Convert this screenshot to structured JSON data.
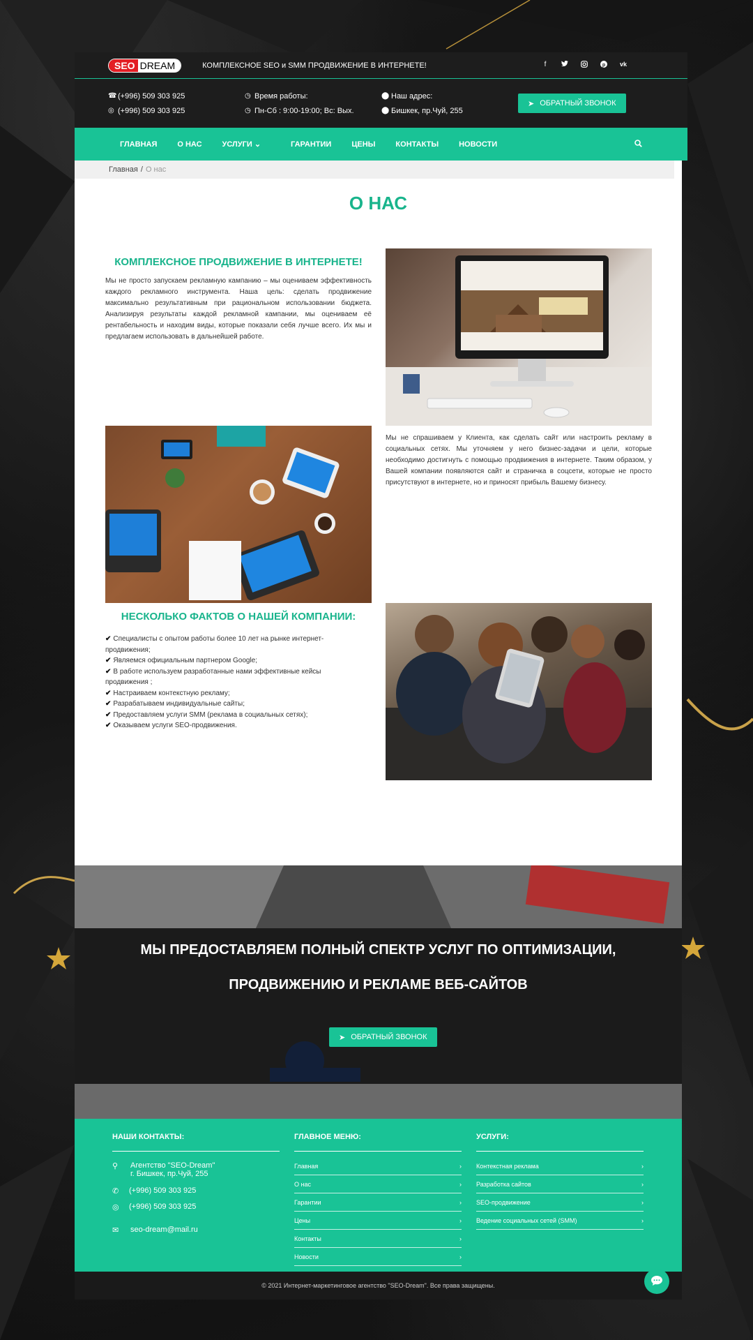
{
  "header": {
    "logo_seo": "SEO",
    "logo_dream": "DREAM",
    "tagline": "КОМПЛЕКСНОЕ SEO и SMM ПРОДВИЖЕНИЕ В ИНТЕРНЕТЕ!",
    "social_icons": [
      "facebook-icon",
      "twitter-icon",
      "instagram-icon",
      "pinterest-icon",
      "vk-icon"
    ]
  },
  "info": {
    "phone1": "(+996) 509 303 925",
    "phone2": "(+996) 509 303 925",
    "hours_label": "Время работы:",
    "hours_value": "Пн-Сб : 9:00-19:00; Вс: Вых.",
    "address_label": "Наш адрес:",
    "address_value": "Бишкек, пр.Чуй, 255",
    "callback": "ОБРАТНЫЙ ЗВОНОК"
  },
  "nav": {
    "items": [
      "ГЛАВНАЯ",
      "О НАС",
      "УСЛУГИ",
      "ГАРАНТИИ",
      "ЦЕНЫ",
      "КОНТАКТЫ",
      "НОВОСТИ"
    ]
  },
  "breadcrumb": {
    "home": "Главная",
    "sep": "/",
    "current": "О нас"
  },
  "page": {
    "title": "О НАС",
    "section1_title": "КОМПЛЕКСНОЕ ПРОДВИЖЕНИЕ В ИНТЕРНЕТЕ!",
    "section1_text": "Мы не просто запускаем рекламную кампанию – мы оцениваем эффективность каждого рекламного инструмента. Наша цель: сделать продвижение максимально результативным при рациональном использовании бюджета. Анализируя результаты каждой рекламной кампании, мы оцениваем её рентабельность и находим виды, которые показали себя лучше всего. Их мы и предлагаем использовать в дальнейшей работе.",
    "section2_text": "Мы не спрашиваем у Клиента, как сделать сайт или настроить рекламу в социальных сетях. Мы уточняем у него бизнес-задачи и цели, которые необходимо достигнуть с помощью продвижения в интернете. Таким образом, у Вашей компании появляются сайт и страничка в соцсети, которые не просто присутствуют в интернете, но и приносят прибыль Вашему бизнесу.",
    "facts_title": "НЕСКОЛЬКО ФАКТОВ О НАШЕЙ КОМПАНИИ:",
    "facts": [
      "Специалисты с опытом работы более 10 лет на рынке интернет-продвижения;",
      "Являемся официальным партнером Google;",
      "В работе используем разработанные нами эффективные кейсы продвижения ;",
      "Настраиваем контекстную рекламу;",
      "Разрабатываем индивидуальные сайты;",
      "Предоставляем услуги SMM (реклама в социальных сетях);",
      "Оказываем услуги SEO-продвижения."
    ]
  },
  "banner": {
    "line1": "МЫ ПРЕДОСТАВЛЯЕМ ПОЛНЫЙ СПЕКТР УСЛУГ ПО ОПТИМИЗАЦИИ,",
    "line2": "ПРОДВИЖЕНИЮ И РЕКЛАМЕ ВЕБ-САЙТОВ",
    "button": "ОБРАТНЫЙ ЗВОНОК"
  },
  "footer": {
    "contacts_title": "НАШИ КОНТАКТЫ:",
    "agency": "Агентство \"SEO-Dream\"",
    "address": "г. Бишкек, пр.Чуй, 255",
    "phone1": "(+996) 509 303 925",
    "phone2": "(+996) 509 303 925",
    "email": "seo-dream@mail.ru",
    "menu_title": "ГЛАВНОЕ МЕНЮ:",
    "menu": [
      "Главная",
      "О нас",
      "Гарантии",
      "Цены",
      "Контакты",
      "Новости"
    ],
    "services_title": "УСЛУГИ:",
    "services": [
      "Контекстная реклама",
      "Разработка сайтов",
      "SEO-продвижение",
      "Ведение социальных сетей (SMM)"
    ],
    "copyright": "© 2021 Интернет-маркетинговое агентство \"SEO-Dream\". Все права защищены."
  },
  "colors": {
    "accent": "#19c396",
    "dark": "#1d1d1d"
  }
}
